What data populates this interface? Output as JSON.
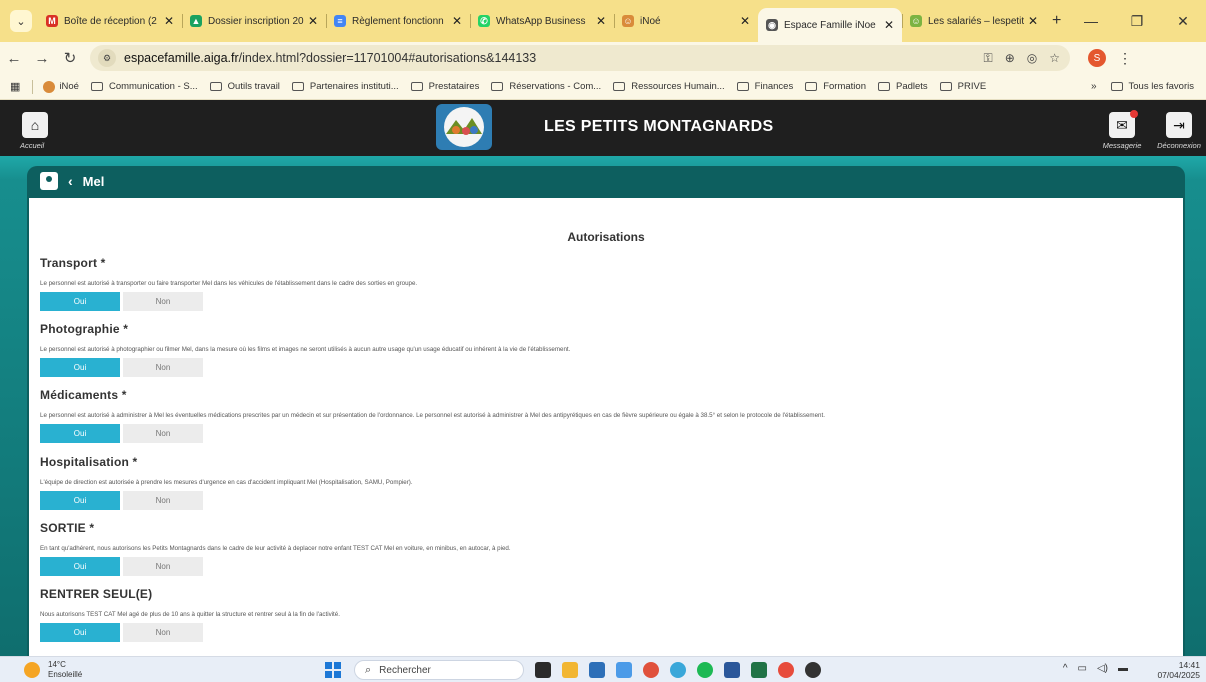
{
  "browser": {
    "tabs": [
      {
        "label": "Boîte de réception (2",
        "icon_color": "#d93025",
        "icon_glyph": "M",
        "active": false
      },
      {
        "label": "Dossier inscription 20",
        "icon_color": "#1aa260",
        "icon_glyph": "▲",
        "active": false
      },
      {
        "label": "Règlement fonctionn",
        "icon_color": "#4285f4",
        "icon_glyph": "≡",
        "active": false
      },
      {
        "label": "WhatsApp Business",
        "icon_color": "#25d366",
        "icon_glyph": "✆",
        "active": false
      },
      {
        "label": "iNoé",
        "icon_color": "#d98b3a",
        "icon_glyph": "☺",
        "active": false
      },
      {
        "label": "Espace Famille iNoe",
        "icon_color": "#555555",
        "icon_glyph": "◉",
        "active": true
      },
      {
        "label": "Les salariés – lespetit",
        "icon_color": "#7cb342",
        "icon_glyph": "☺",
        "active": false
      }
    ],
    "url_host": "espacefamille.aiga.fr",
    "url_path": "/index.html?dossier=11701004#autorisations&144133",
    "profile_initial": "S",
    "bookmarks": [
      "iNoé",
      "Communication - S...",
      "Outils travail",
      "Partenaires instituti...",
      "Prestataires",
      "Réservations - Com...",
      "Ressources Humain...",
      "Finances",
      "Formation",
      "Padlets",
      "PRIVE"
    ],
    "bookmarks_more": "»",
    "all_bookmarks": "Tous les favoris"
  },
  "app": {
    "home_label": "Accueil",
    "title": "LES PETITS MONTAGNARDS",
    "messages_label": "Messagerie",
    "logout_label": "Déconnexion"
  },
  "child": {
    "name": "Mel"
  },
  "page": {
    "title": "Autorisations",
    "yes_label": "Oui",
    "no_label": "Non",
    "sections": [
      {
        "title": "Transport *",
        "text": "Le personnel est autorisé à transporter ou faire transporter Mel dans les véhicules de l'établissement dans le cadre des sorties en groupe.",
        "selected": "Oui"
      },
      {
        "title": "Photographie *",
        "text": "Le personnel est autorisé à photographier ou filmer Mel, dans la mesure où les films et images ne seront utilisés à aucun autre usage qu'un usage éducatif ou inhérent à la vie de l'établissement.",
        "selected": "Oui"
      },
      {
        "title": "Médicaments *",
        "text": "Le personnel est autorisé à administrer à Mel les éventuelles médications prescrites par un médecin et sur présentation de l'ordonnance. Le personnel est autorisé à administrer à Mel des antipyrétiques en cas de fièvre supérieure ou égale à 38.5° et selon le protocole de l'établissement.",
        "selected": "Oui"
      },
      {
        "title": "Hospitalisation *",
        "text": "L'équipe de direction est autorisée à prendre les mesures d'urgence en cas d'accident impliquant Mel (Hospitalisation, SAMU, Pompier).",
        "selected": "Oui"
      },
      {
        "title": "SORTIE *",
        "text": "En tant qu'adhérent, nous autorisons les Petits Montagnards dans le cadre de leur activité à deplacer notre enfant TEST CAT Mel en voiture, en minibus, en autocar, à pied.",
        "selected": "Oui"
      },
      {
        "title": "RENTRER SEUL(E)",
        "text": "Nous autorisons TEST CAT Mel agé de plus de 10 ans à quitter la structure et rentrer seul à la fin de l'activité.",
        "selected": "Oui"
      }
    ]
  },
  "taskbar": {
    "temperature": "14°C",
    "weather": "Ensoleillé",
    "search_placeholder": "Rechercher",
    "time": "14:41",
    "date": "07/04/2025"
  },
  "colors": {
    "accent": "#29b1d1",
    "teal": "#0d5f5f",
    "header": "#1f1f1f"
  }
}
